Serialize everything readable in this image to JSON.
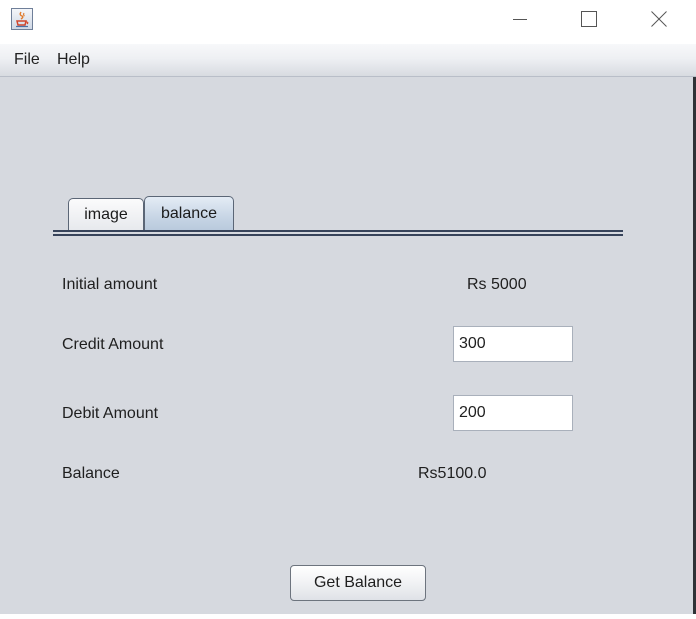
{
  "window": {
    "title": "",
    "icon": "java-cup-icon",
    "controls": [
      "minimize-icon",
      "maximize-icon",
      "close-icon"
    ]
  },
  "menu": {
    "file": "File",
    "help": "Help"
  },
  "tabs": [
    {
      "label": "image",
      "selected": false
    },
    {
      "label": "balance",
      "selected": true
    }
  ],
  "form": {
    "initial_label": "Initial amount",
    "initial_value": "Rs 5000",
    "credit_label": "Credit Amount",
    "credit_value": "300",
    "debit_label": "Debit Amount",
    "debit_value": "200",
    "balance_label": "Balance",
    "balance_value": "Rs5100.0",
    "button_label": "Get Balance"
  },
  "colors": {
    "background": "#d6d9df",
    "selected_tab": "#c7d5e5",
    "tab_underline": "#37435a"
  }
}
